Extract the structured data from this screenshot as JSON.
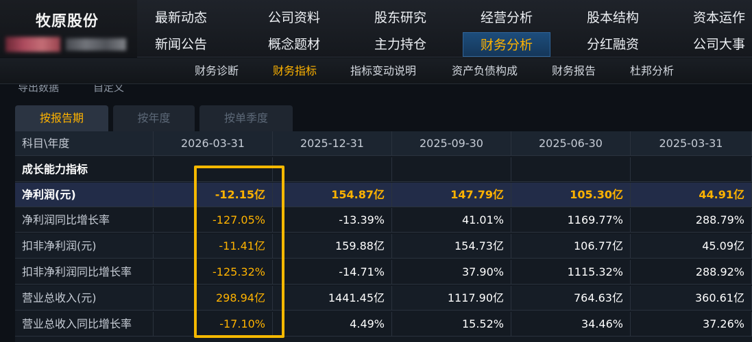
{
  "brand": {
    "name": "牧原股份"
  },
  "nav": {
    "row1": [
      "最新动态",
      "公司资料",
      "股东研究",
      "经营分析",
      "股本结构",
      "资本运作"
    ],
    "row2": [
      "新闻公告",
      "概念题材",
      "主力持仓",
      "财务分析",
      "分红融资",
      "公司大事"
    ],
    "active": "财务分析"
  },
  "subnav": {
    "items": [
      "财务诊断",
      "财务指标",
      "指标变动说明",
      "资产负债构成",
      "财务报告",
      "杜邦分析"
    ],
    "active": "财务指标"
  },
  "partial_strip": {
    "left": "导出数据",
    "right": "自定义"
  },
  "tabs": {
    "items": [
      "按报告期",
      "按年度",
      "按单季度"
    ],
    "active": "按报告期"
  },
  "table": {
    "corner": "科目\\年度",
    "periods": [
      "2026-03-31",
      "2025-12-31",
      "2025-09-30",
      "2025-06-30",
      "2025-03-31"
    ],
    "section": "成长能力指标",
    "rows": [
      {
        "label": "净利润(元)",
        "values": [
          "-12.15亿",
          "154.87亿",
          "147.79亿",
          "105.30亿",
          "44.91亿"
        ],
        "highlight": true
      },
      {
        "label": "净利润同比增长率",
        "values": [
          "-127.05%",
          "-13.39%",
          "41.01%",
          "1169.77%",
          "288.79%"
        ]
      },
      {
        "label": "扣非净利润(元)",
        "values": [
          "-11.41亿",
          "159.88亿",
          "154.73亿",
          "106.77亿",
          "45.09亿"
        ]
      },
      {
        "label": "扣非净利润同比增长率",
        "values": [
          "-125.32%",
          "-14.71%",
          "37.90%",
          "1115.32%",
          "288.92%"
        ]
      },
      {
        "label": "营业总收入(元)",
        "values": [
          "298.94亿",
          "1441.45亿",
          "1117.90亿",
          "764.63亿",
          "360.61亿"
        ]
      },
      {
        "label": "营业总收入同比增长率",
        "values": [
          "-17.10%",
          "4.49%",
          "15.52%",
          "34.46%",
          "37.26%"
        ]
      }
    ]
  },
  "colors": {
    "accent": "#ffb300",
    "highlight_box": "#f5b800",
    "background": "#0d1117"
  }
}
